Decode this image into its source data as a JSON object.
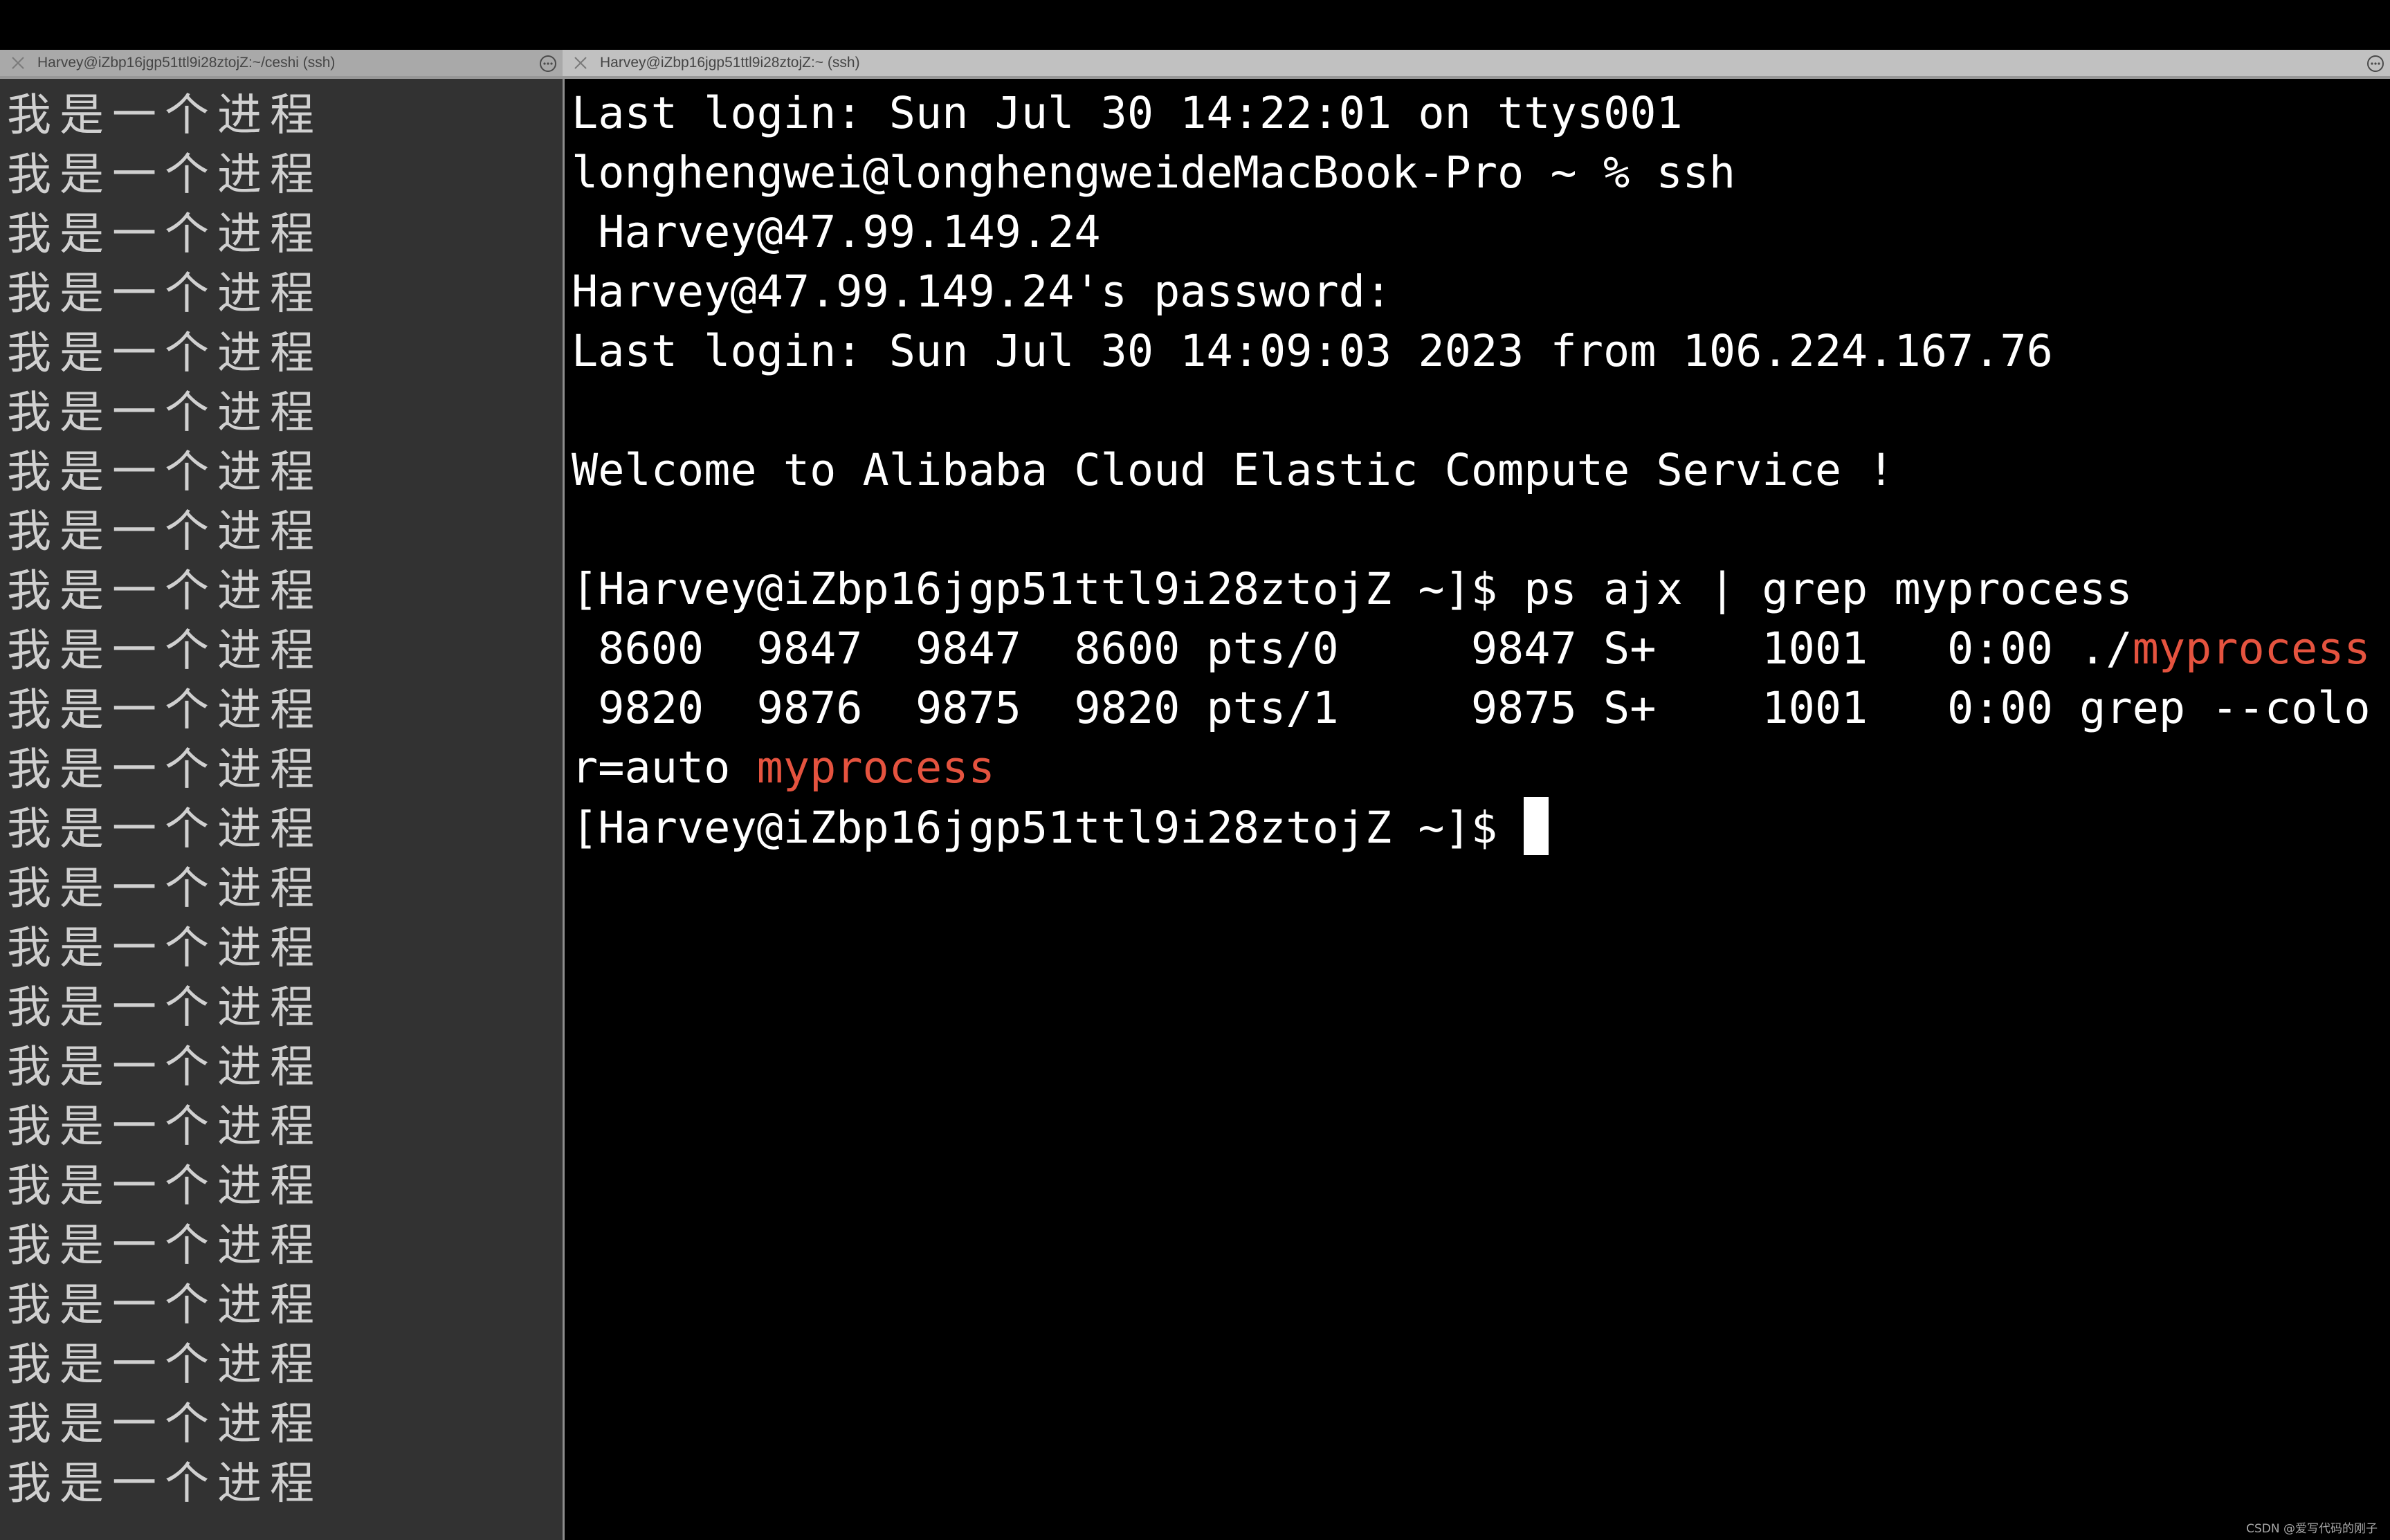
{
  "window": {
    "app": "Terminal"
  },
  "tabs": [
    {
      "title": "Harvey@iZbp16jgp51ttl9i28ztojZ:~/ceshi (ssh)",
      "close_icon": "close-icon",
      "more_icon": "ellipsis-circle-icon",
      "active": false
    },
    {
      "title": "Harvey@iZbp16jgp51ttl9i28ztojZ:~ (ssh)",
      "close_icon": "close-icon",
      "more_icon": "ellipsis-circle-icon",
      "active": true
    }
  ],
  "left_pane": {
    "lines": [
      "我是一个进程",
      "我是一个进程",
      "我是一个进程",
      "我是一个进程",
      "我是一个进程",
      "我是一个进程",
      "我是一个进程",
      "我是一个进程",
      "我是一个进程",
      "我是一个进程",
      "我是一个进程",
      "我是一个进程",
      "我是一个进程",
      "我是一个进程",
      "我是一个进程",
      "我是一个进程",
      "我是一个进程",
      "我是一个进程",
      "我是一个进程",
      "我是一个进程",
      "我是一个进程",
      "我是一个进程",
      "我是一个进程",
      "我是一个进程"
    ]
  },
  "right_pane": {
    "lines": [
      {
        "text": "Last login: Sun Jul 30 14:22:01 on ttys001"
      },
      {
        "text": "longhengwei@longhengweideMacBook-Pro ~ % ssh"
      },
      {
        "text": " Harvey@47.99.149.24"
      },
      {
        "text": "Harvey@47.99.149.24's password:"
      },
      {
        "text": "Last login: Sun Jul 30 14:09:03 2023 from 106.224.167.76"
      },
      {
        "text": ""
      },
      {
        "text": "Welcome to Alibaba Cloud Elastic Compute Service !"
      },
      {
        "text": ""
      },
      {
        "text": "[Harvey@iZbp16jgp51ttl9i28ztojZ ~]$ ps ajx | grep myprocess"
      },
      {
        "text": " 8600  9847  9847  8600 pts/0     9847 S+    1001   0:00 ./",
        "highlight": "myprocess"
      },
      {
        "text": " 9820  9876  9875  9820 pts/1     9875 S+    1001   0:00 grep --colo"
      },
      {
        "text": "r=auto ",
        "highlight": "myprocess"
      },
      {
        "text": "[Harvey@iZbp16jgp51ttl9i28ztojZ ~]$ ",
        "cursor": true
      }
    ],
    "highlight_color": "#e5533f"
  },
  "watermark": "CSDN @爱写代码的刚子"
}
